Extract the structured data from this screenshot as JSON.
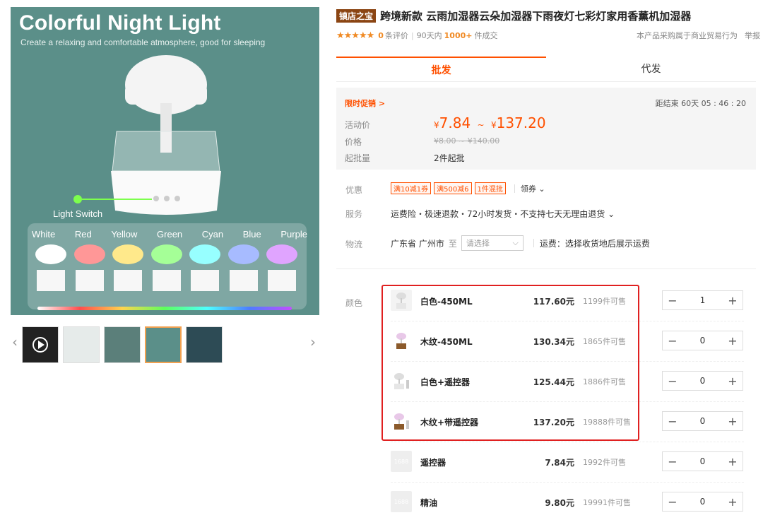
{
  "gallery": {
    "hero_title": "Colorful Night Light",
    "hero_subtitle": "Create a relaxing and comfortable atmosphere, good for sleeping",
    "light_switch_label": "Light Switch",
    "color_names": [
      "White",
      "Red",
      "Yellow",
      "Green",
      "Cyan",
      "Blue",
      "Purple"
    ],
    "prev_arrow": "‹",
    "next_arrow": "›"
  },
  "header": {
    "shop_tag": "镇店之宝",
    "title": "跨境新款 云雨加湿器云朵加湿器下雨夜灯七彩灯家用香薰机加湿器"
  },
  "rating": {
    "stars": "★★★★★",
    "review_count": "0",
    "review_label": "条评价",
    "sales_prefix": "90天内",
    "sales_count": "1000+",
    "sales_suffix": "件成交",
    "trade_note": "本产品采购属于商业贸易行为",
    "report": "举报"
  },
  "tabs": [
    {
      "label": "批发"
    },
    {
      "label": "代发"
    }
  ],
  "price_box": {
    "promo_label": "限时促销 >",
    "countdown": "距结束 60天 05 : 46 : 20",
    "activity_label": "活动价",
    "activity_low": "7.84",
    "activity_high": "137.20",
    "currency": "¥",
    "range_sep": "~",
    "price_label": "价格",
    "orig_range": "¥8.00 ~ ¥140.00",
    "moq_label": "起批量",
    "moq_value": "2件起批"
  },
  "offers": {
    "label": "优惠",
    "coupons": [
      "满10减1券",
      "满500减6",
      "1件混批"
    ],
    "claim": "领券 ⌄"
  },
  "service": {
    "label": "服务",
    "value": "运费险・极速退款・72小时发货・不支持七天无理由退货 ⌄"
  },
  "logistics": {
    "label": "物流",
    "origin": "广东省 广州市",
    "to": "至",
    "select_placeholder": "请选择",
    "shipping_note": "运费：选择收货地后展示运费"
  },
  "sku": {
    "label": "颜色",
    "items": [
      {
        "name": "白色-450ML",
        "price": "117.60元",
        "stock": "1199件可售",
        "qty": "1"
      },
      {
        "name": "木纹-450ML",
        "price": "130.34元",
        "stock": "1865件可售",
        "qty": "0"
      },
      {
        "name": "白色+遥控器",
        "price": "125.44元",
        "stock": "1886件可售",
        "qty": "0"
      },
      {
        "name": "木纹+带遥控器",
        "price": "137.20元",
        "stock": "19888件可售",
        "qty": "0"
      },
      {
        "name": "遥控器",
        "price": "7.84元",
        "stock": "1992件可售",
        "qty": "0"
      },
      {
        "name": "精油",
        "price": "9.80元",
        "stock": "19991件可售",
        "qty": "0"
      }
    ],
    "placeholder_text": "1688",
    "minus": "−",
    "plus": "+"
  },
  "colors": {
    "accent": "#ff5000",
    "highlight_border": "#e02020",
    "hero_bg": "#5b8f89"
  }
}
